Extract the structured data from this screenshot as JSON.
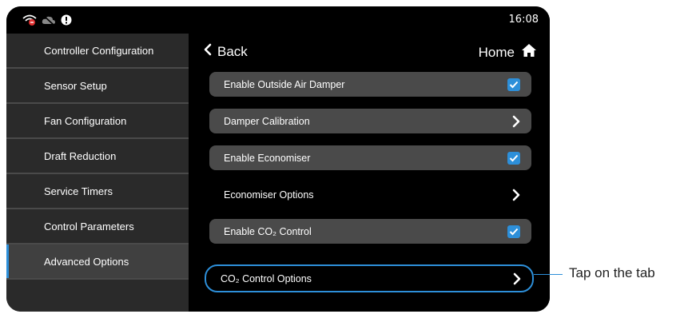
{
  "status": {
    "time": "16:08"
  },
  "sidebar": {
    "items": [
      {
        "label": "Controller Configuration"
      },
      {
        "label": "Sensor Setup"
      },
      {
        "label": "Fan Configuration"
      },
      {
        "label": "Draft Reduction"
      },
      {
        "label": "Service Timers"
      },
      {
        "label": "Control Parameters"
      },
      {
        "label": "Advanced Options",
        "active": true
      }
    ]
  },
  "nav": {
    "back_label": "Back",
    "home_label": "Home"
  },
  "options": [
    {
      "label": "Enable Outside Air Damper",
      "control": "checkbox",
      "checked": true
    },
    {
      "label": "Damper Calibration",
      "control": "chevron"
    },
    {
      "label": "Enable Economiser",
      "control": "checkbox",
      "checked": true
    },
    {
      "label": "Economiser Options",
      "control": "chevron"
    },
    {
      "label": "Enable CO₂ Control",
      "control": "checkbox",
      "checked": true
    },
    {
      "label": "CO₂ Control Options",
      "control": "chevron",
      "highlighted": true
    }
  ],
  "annotation": {
    "text": "Tap on the tab"
  },
  "colors": {
    "accent": "#2d8fd9",
    "sidebar_bg": "#2a2a2a",
    "row_bg": "#4a4a4a"
  }
}
